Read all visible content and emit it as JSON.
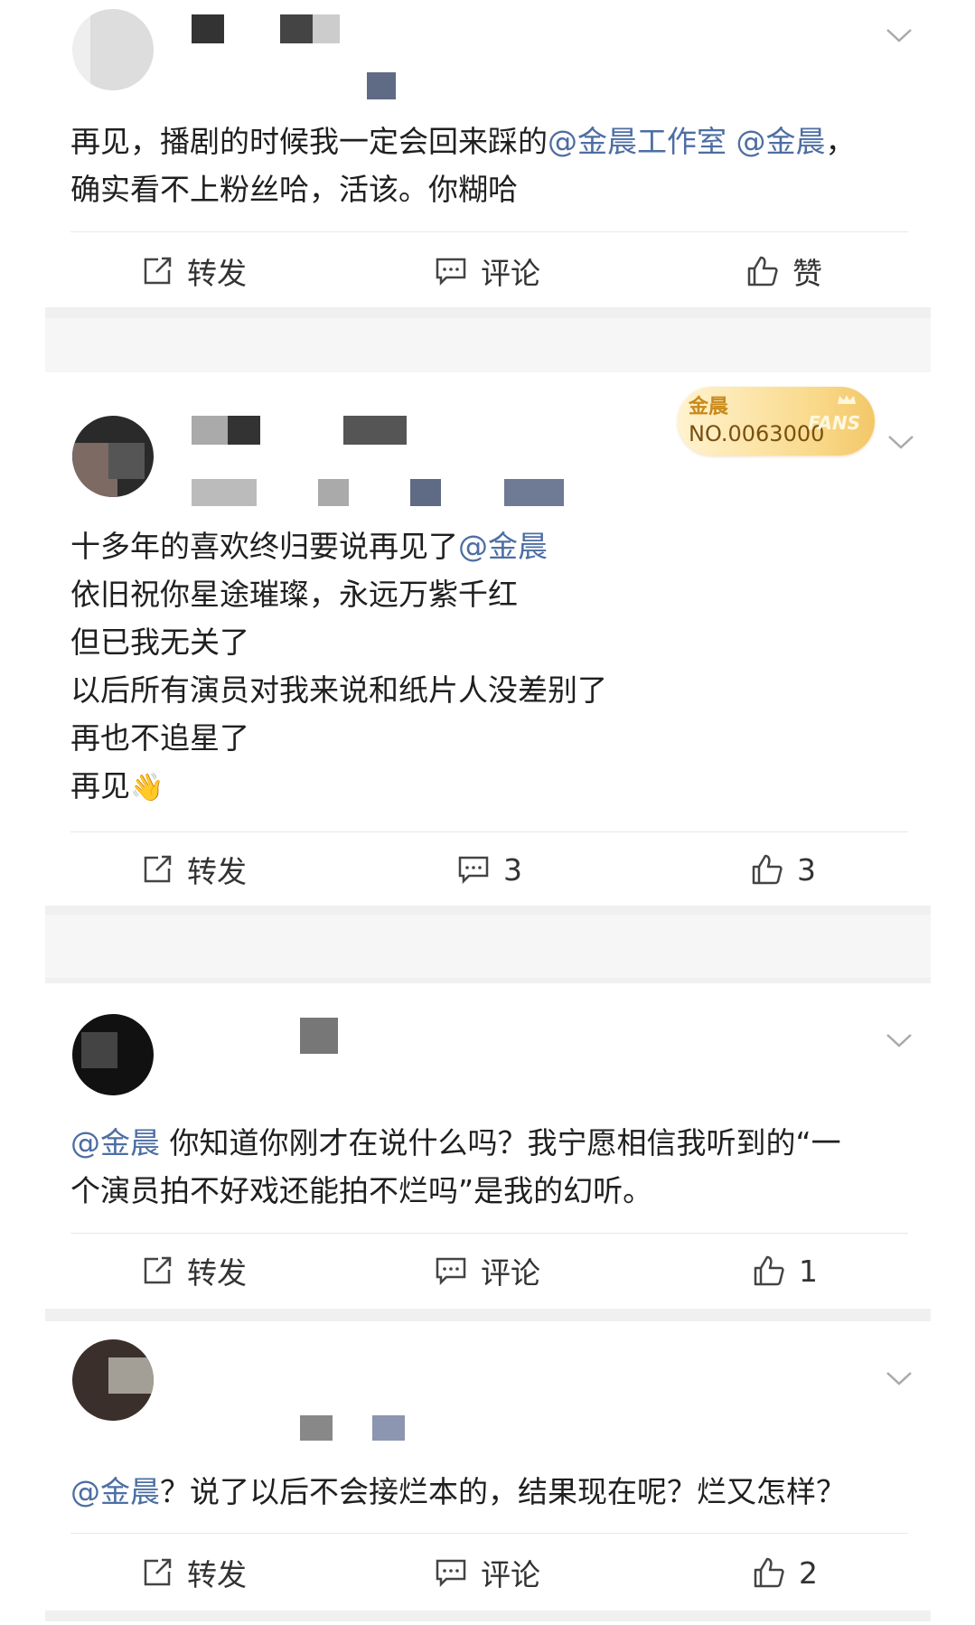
{
  "posts": [
    {
      "text_before": "再见，播剧的时候我一定会回来踩的",
      "mention1": "@金晨工作室",
      "mention2": "@金晨",
      "text_after": "，\n确实看不上粉丝哈，活该。你糊哈",
      "actions": {
        "repost": "转发",
        "comment": "评论",
        "like": "赞"
      }
    },
    {
      "badge": {
        "name": "金晨",
        "number": "NO.0063000",
        "fans": "FANS"
      },
      "line1_text": "十多年的喜欢终归要说再见了",
      "line1_mention": "@金晨",
      "lines": [
        "依旧祝你星途璀璨，永远万紫千红",
        "但已我无关了",
        "以后所有演员对我来说和纸片人没差别了",
        "再也不追星了"
      ],
      "last_line": "再见",
      "emoji": "👋",
      "actions": {
        "repost": "转发",
        "comment": "3",
        "like": "3"
      }
    },
    {
      "mention": "@金晨",
      "text": " 你知道你刚才在说什么吗？我宁愿相信我听到的“一\n个演员拍不好戏还能拍不烂吗”是我的幻听。",
      "actions": {
        "repost": "转发",
        "comment": "评论",
        "like": "1"
      }
    },
    {
      "mention": "@金晨",
      "text": "？说了以后不会接烂本的，结果现在呢？烂又怎样？",
      "actions": {
        "repost": "转发",
        "comment": "评论",
        "like": "2"
      }
    }
  ],
  "colors": {
    "mention": "#4d6ea3",
    "badge_gold": "#f3c768",
    "divider": "#e8e8e8"
  },
  "icons": {
    "repost": "share-icon",
    "comment": "comment-icon",
    "like": "thumb-up-icon",
    "more": "chevron-down-icon"
  }
}
